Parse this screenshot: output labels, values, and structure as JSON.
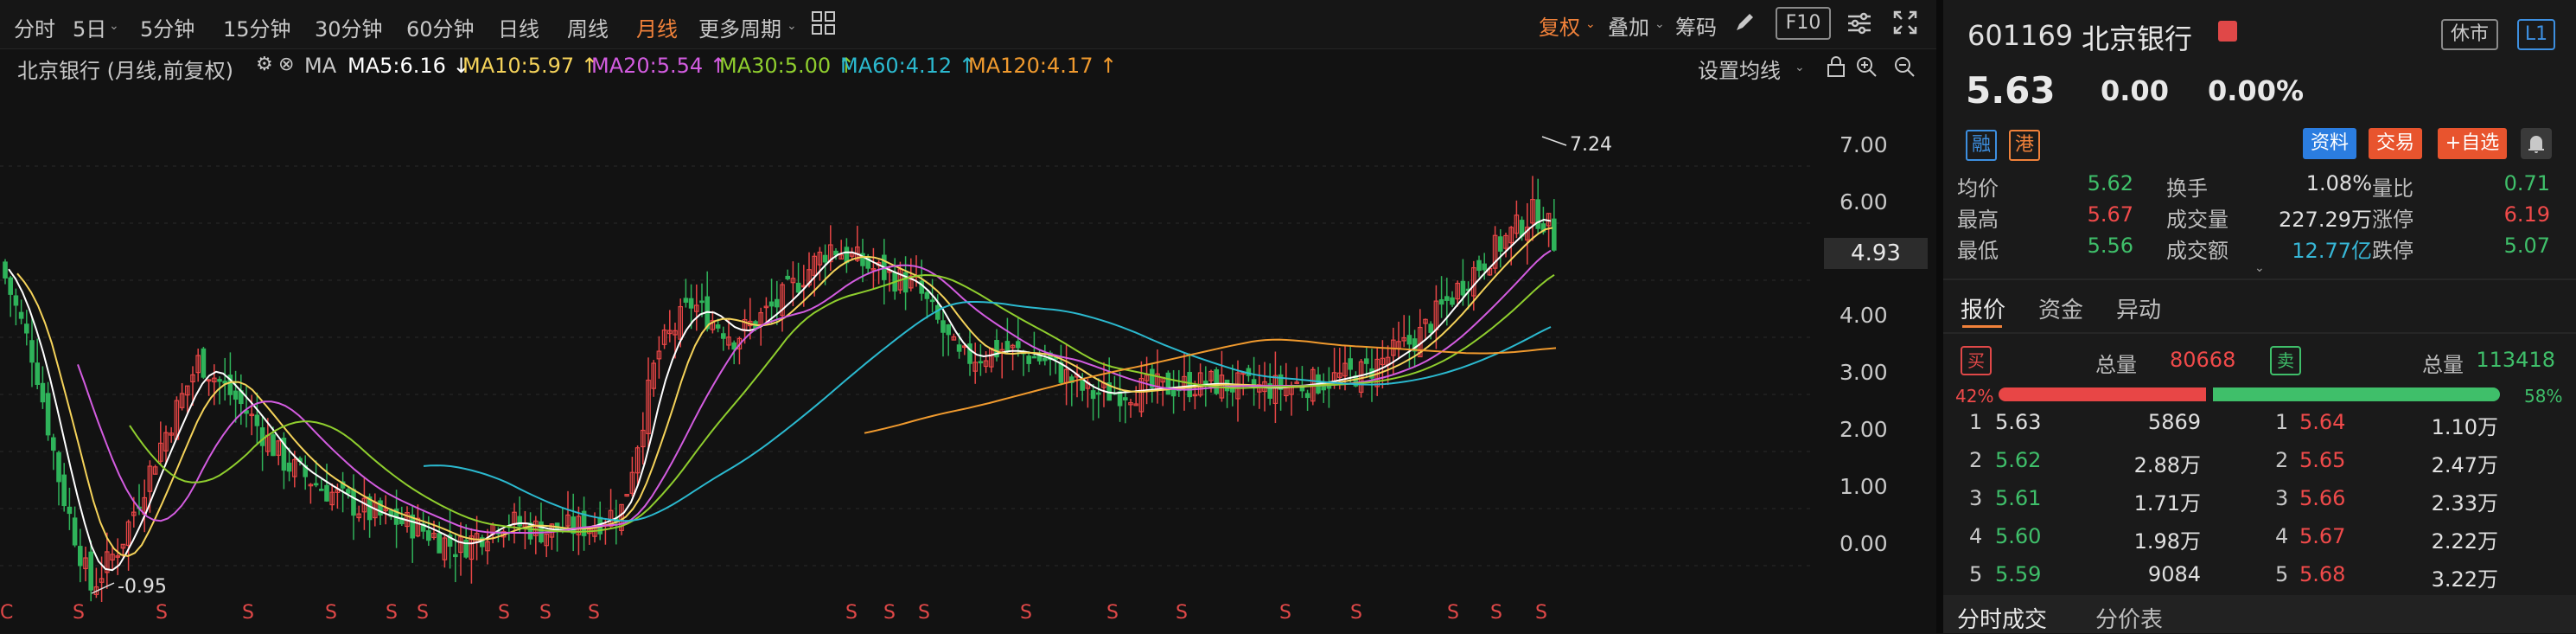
{
  "periods": [
    "分时",
    "5日",
    "5分钟",
    "15分钟",
    "30分钟",
    "60分钟",
    "日线",
    "周线",
    "月线",
    "更多周期"
  ],
  "active_period": "月线",
  "toolbar_right": {
    "fuquan": "复权",
    "diejia": "叠加",
    "chouma": "筹码",
    "f10": "F10"
  },
  "chart_title": "北京银行 (月线,前复权)",
  "ma_label": "MA",
  "ma": [
    {
      "label": "MA5:6.16 ↓",
      "color": "#ffffff"
    },
    {
      "label": "MA10:5.97 ↑",
      "color": "#f5d35a"
    },
    {
      "label": "MA20:5.54 ↑",
      "color": "#d35ce0"
    },
    {
      "label": "MA30:5.00 ↑",
      "color": "#8fce2e"
    },
    {
      "label": "MA60:4.12 ↑",
      "color": "#2bb9cf"
    },
    {
      "label": "MA120:4.17 ↑",
      "color": "#f09a2e"
    }
  ],
  "ma_settings": "设置均线",
  "current_price_box": "4.93",
  "y_ticks": [
    "7.00",
    "6.00",
    "5.00",
    "4.00",
    "3.00",
    "2.00",
    "1.00",
    "0.00"
  ],
  "annotations": {
    "high": "7.24",
    "low": "-0.95"
  },
  "left_marker": "C",
  "s_marker": "S",
  "stock": {
    "code": "601169",
    "name": "北京银行",
    "market_status": "休市",
    "level": "L1",
    "price": "5.63",
    "change": "0.00",
    "change_pct": "0.00%"
  },
  "tags": {
    "rong": "融",
    "gang": "港",
    "ziliao": "资料",
    "jiaoyi": "交易",
    "zixuan": "+自选"
  },
  "stats": [
    [
      {
        "l": "均价",
        "v": "5.62",
        "c": "green"
      },
      {
        "l": "换手",
        "v": "1.08%",
        "c": "white"
      },
      {
        "l": "量比",
        "v": "0.71",
        "c": "green"
      }
    ],
    [
      {
        "l": "最高",
        "v": "5.67",
        "c": "red"
      },
      {
        "l": "成交量",
        "v": "227.29万",
        "c": "white"
      },
      {
        "l": "涨停",
        "v": "6.19",
        "c": "red"
      }
    ],
    [
      {
        "l": "最低",
        "v": "5.56",
        "c": "green"
      },
      {
        "l": "成交额",
        "v": "12.77亿",
        "c": "cyan"
      },
      {
        "l": "跌停",
        "v": "5.07",
        "c": "green"
      }
    ]
  ],
  "tabs": [
    "报价",
    "资金",
    "异动"
  ],
  "orderbook": {
    "buy_label": "买",
    "sell_label": "卖",
    "total_label": "总量",
    "buy_total": "80668",
    "sell_total": "113418",
    "buy_pct": "42%",
    "sell_pct": "58%",
    "buy_ratio": 0.42,
    "bids": [
      {
        "n": "1",
        "p": "5.63",
        "v": "5869",
        "c": "white"
      },
      {
        "n": "2",
        "p": "5.62",
        "v": "2.88万",
        "c": "green"
      },
      {
        "n": "3",
        "p": "5.61",
        "v": "1.71万",
        "c": "green"
      },
      {
        "n": "4",
        "p": "5.60",
        "v": "1.98万",
        "c": "green"
      },
      {
        "n": "5",
        "p": "5.59",
        "v": "9084",
        "c": "green"
      }
    ],
    "asks": [
      {
        "n": "1",
        "p": "5.64",
        "v": "1.10万"
      },
      {
        "n": "2",
        "p": "5.65",
        "v": "2.47万"
      },
      {
        "n": "3",
        "p": "5.66",
        "v": "2.33万"
      },
      {
        "n": "4",
        "p": "5.67",
        "v": "2.22万"
      },
      {
        "n": "5",
        "p": "5.68",
        "v": "3.22万"
      }
    ]
  },
  "bottom_tabs": [
    "分时成交",
    "分价表"
  ]
}
